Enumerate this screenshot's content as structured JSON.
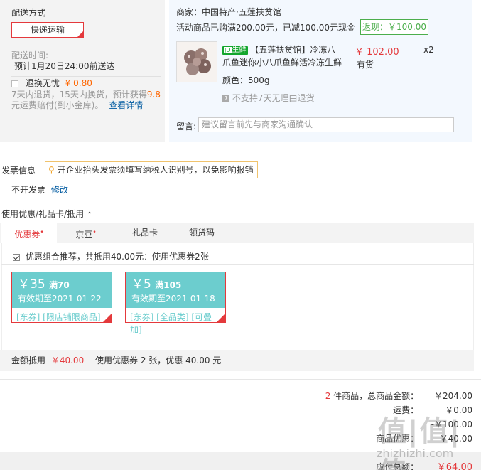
{
  "shipping": {
    "title": "配送方式",
    "method": "快递运输",
    "time_label": "配送时间:",
    "time_value": "预计1月20日24:00前送达",
    "insurance_label": "退换无忧",
    "insurance_price": "¥ 0.80",
    "insurance_desc_1": "7天内退货，15天内换货，预计获得",
    "insurance_points": "9.8",
    "insurance_desc_2": "元运费赔付(到小金库)。",
    "insurance_link": "查看详情"
  },
  "product_panel": {
    "merchant": "商家：中国特产·五莲扶贫馆",
    "promo": "活动商品已购满200.00元，已减100.00元现金",
    "fanxian": "返现：￥100.00",
    "tag": "生鲜",
    "name_line1": "【五莲扶贫馆】冷冻八",
    "name_line2": "爪鱼迷你小八爪鱼鲜活冷冻生鲜",
    "price": "￥ 102.00",
    "qty": "x2",
    "stock": "有货",
    "spec": "颜色：500g",
    "no_return": "不支持7天无理由退货",
    "message_label": "留言:",
    "message_placeholder": "建议留言前先与商家沟通确认"
  },
  "invoice": {
    "title": "发票信息",
    "tip": "开企业抬头发票须填写纳税人识别号，以免影响报销",
    "value": "不开发票",
    "edit": "修改"
  },
  "coupons": {
    "section_title": "使用优惠/礼品卡/抵用",
    "tabs": [
      {
        "label": "优惠券",
        "mark": "•"
      },
      {
        "label": "京豆",
        "mark": "•"
      },
      {
        "label": "礼品卡",
        "mark": ""
      },
      {
        "label": "领货码",
        "mark": ""
      }
    ],
    "combo_text": "优惠组合推荐，共抵用40.00元：使用优惠券2张",
    "items": [
      {
        "amount": "￥35",
        "cond": "满70",
        "expiry": "有效期至2021-01-22",
        "scope": "[东券] [限店铺限商品]"
      },
      {
        "amount": "￥5",
        "cond": "满105",
        "expiry": "有效期至2021-01-18",
        "scope": "[东券] [全品类] [可叠加]"
      }
    ],
    "summary_label": "金额抵用",
    "summary_amount": "￥40.00",
    "summary_desc": "使用优惠券 2 张，优惠 40.00 元"
  },
  "totals": {
    "count": "2",
    "count_label": "件商品，总商品金额：",
    "goods_total": "￥204.00",
    "freight_label": "运费：",
    "freight": "￥0.00",
    "row3_value": "-￥100.00",
    "discount_label": "商品优惠：",
    "discount": "-￥40.00",
    "pay_label": "应付总额：",
    "pay_total": "￥64.00"
  },
  "watermark": {
    "text": "值|值|值",
    "sub": "zhizhizhi.com"
  }
}
